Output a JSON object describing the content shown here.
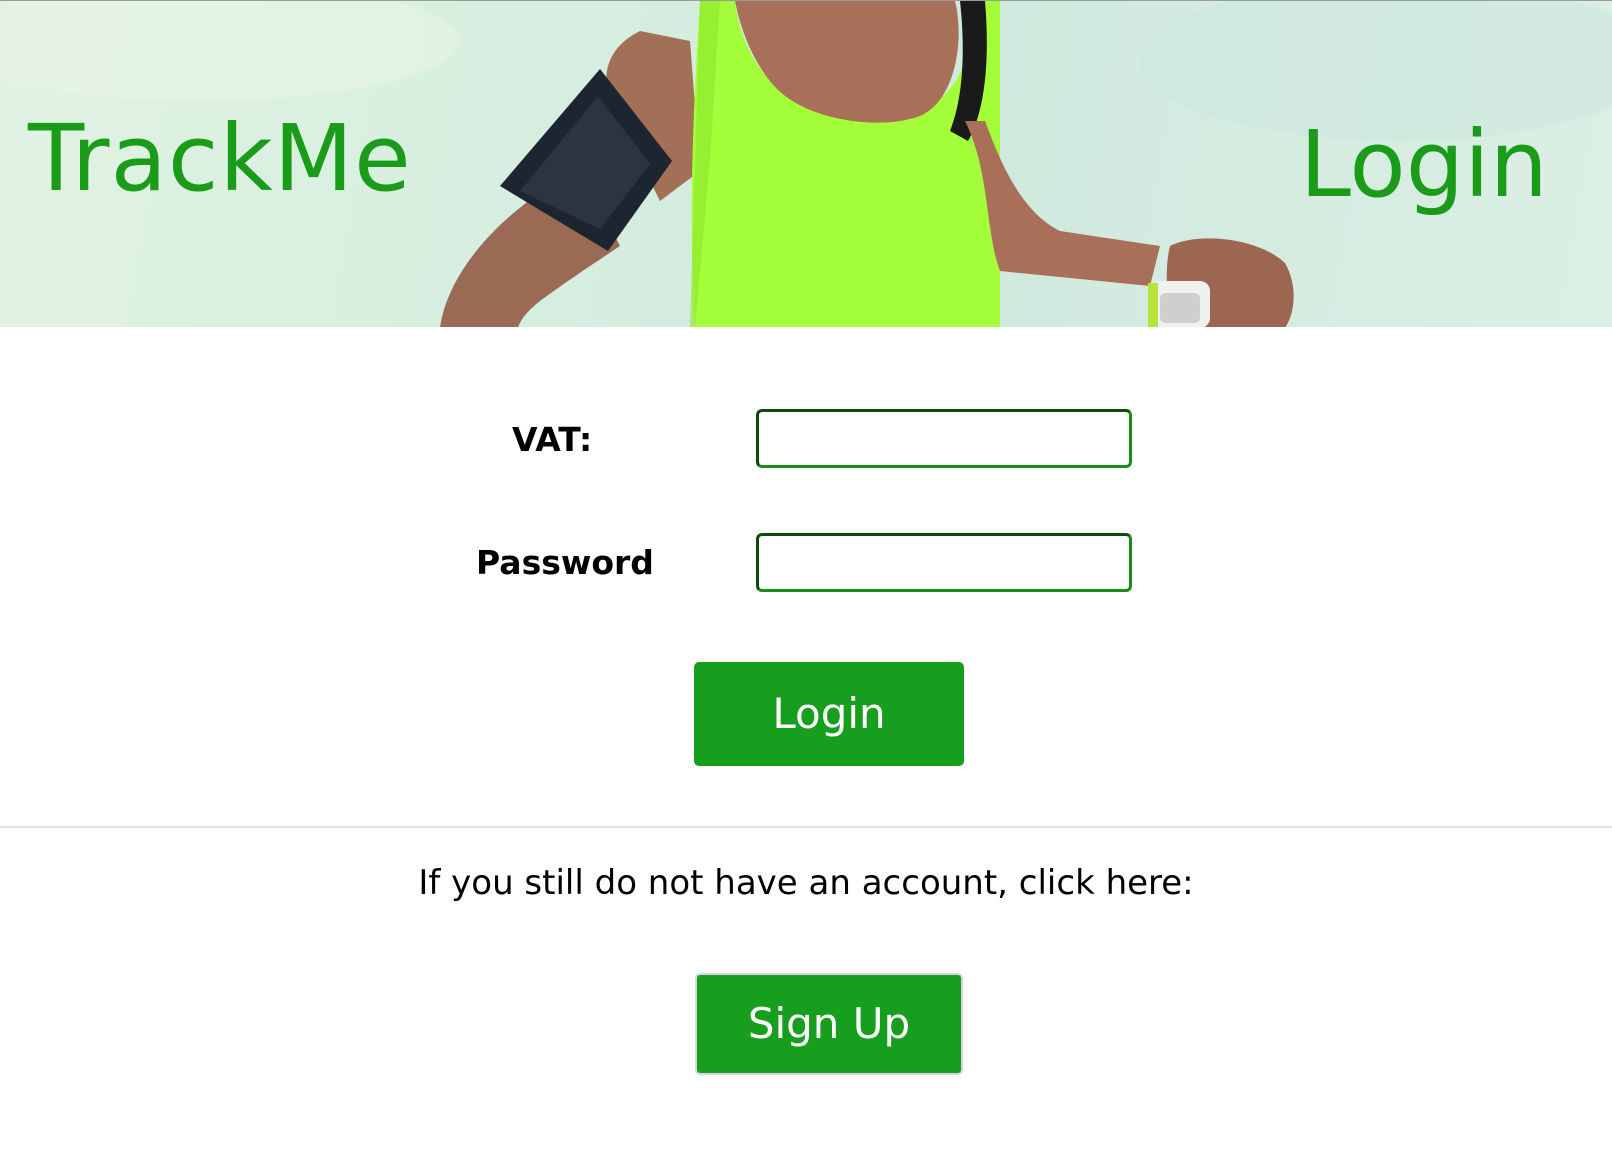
{
  "header": {
    "brand": "TrackMe",
    "page_title": "Login"
  },
  "form": {
    "vat_label": "VAT:",
    "vat_value": "",
    "password_label": "Password",
    "password_value": "",
    "login_button": "Login"
  },
  "signup": {
    "prompt": "If you still do not have an account, click here:",
    "button": "Sign Up"
  },
  "colors": {
    "brand_green": "#1a9b1a",
    "button_green": "#189e1e",
    "input_border": "#1a8c1a"
  }
}
